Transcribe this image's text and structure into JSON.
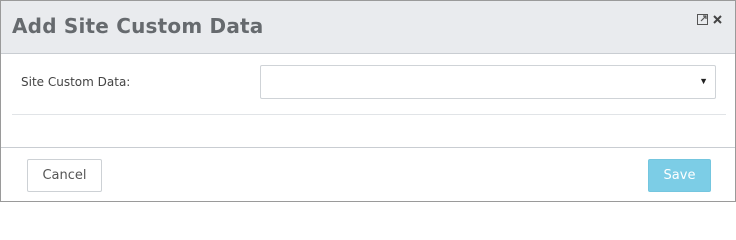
{
  "dialog": {
    "title": "Add Site Custom Data",
    "icons": [
      "expand-icon",
      "close-icon"
    ]
  },
  "form": {
    "site_custom_data": {
      "label": "Site Custom Data:",
      "value": ""
    },
    "caret_glyph": "▼"
  },
  "footer": {
    "cancel_label": "Cancel",
    "save_label": "Save"
  },
  "colors": {
    "header_bg": "#e9ebee",
    "save_button": "#7ccde6",
    "title_text": "#666a6e"
  }
}
